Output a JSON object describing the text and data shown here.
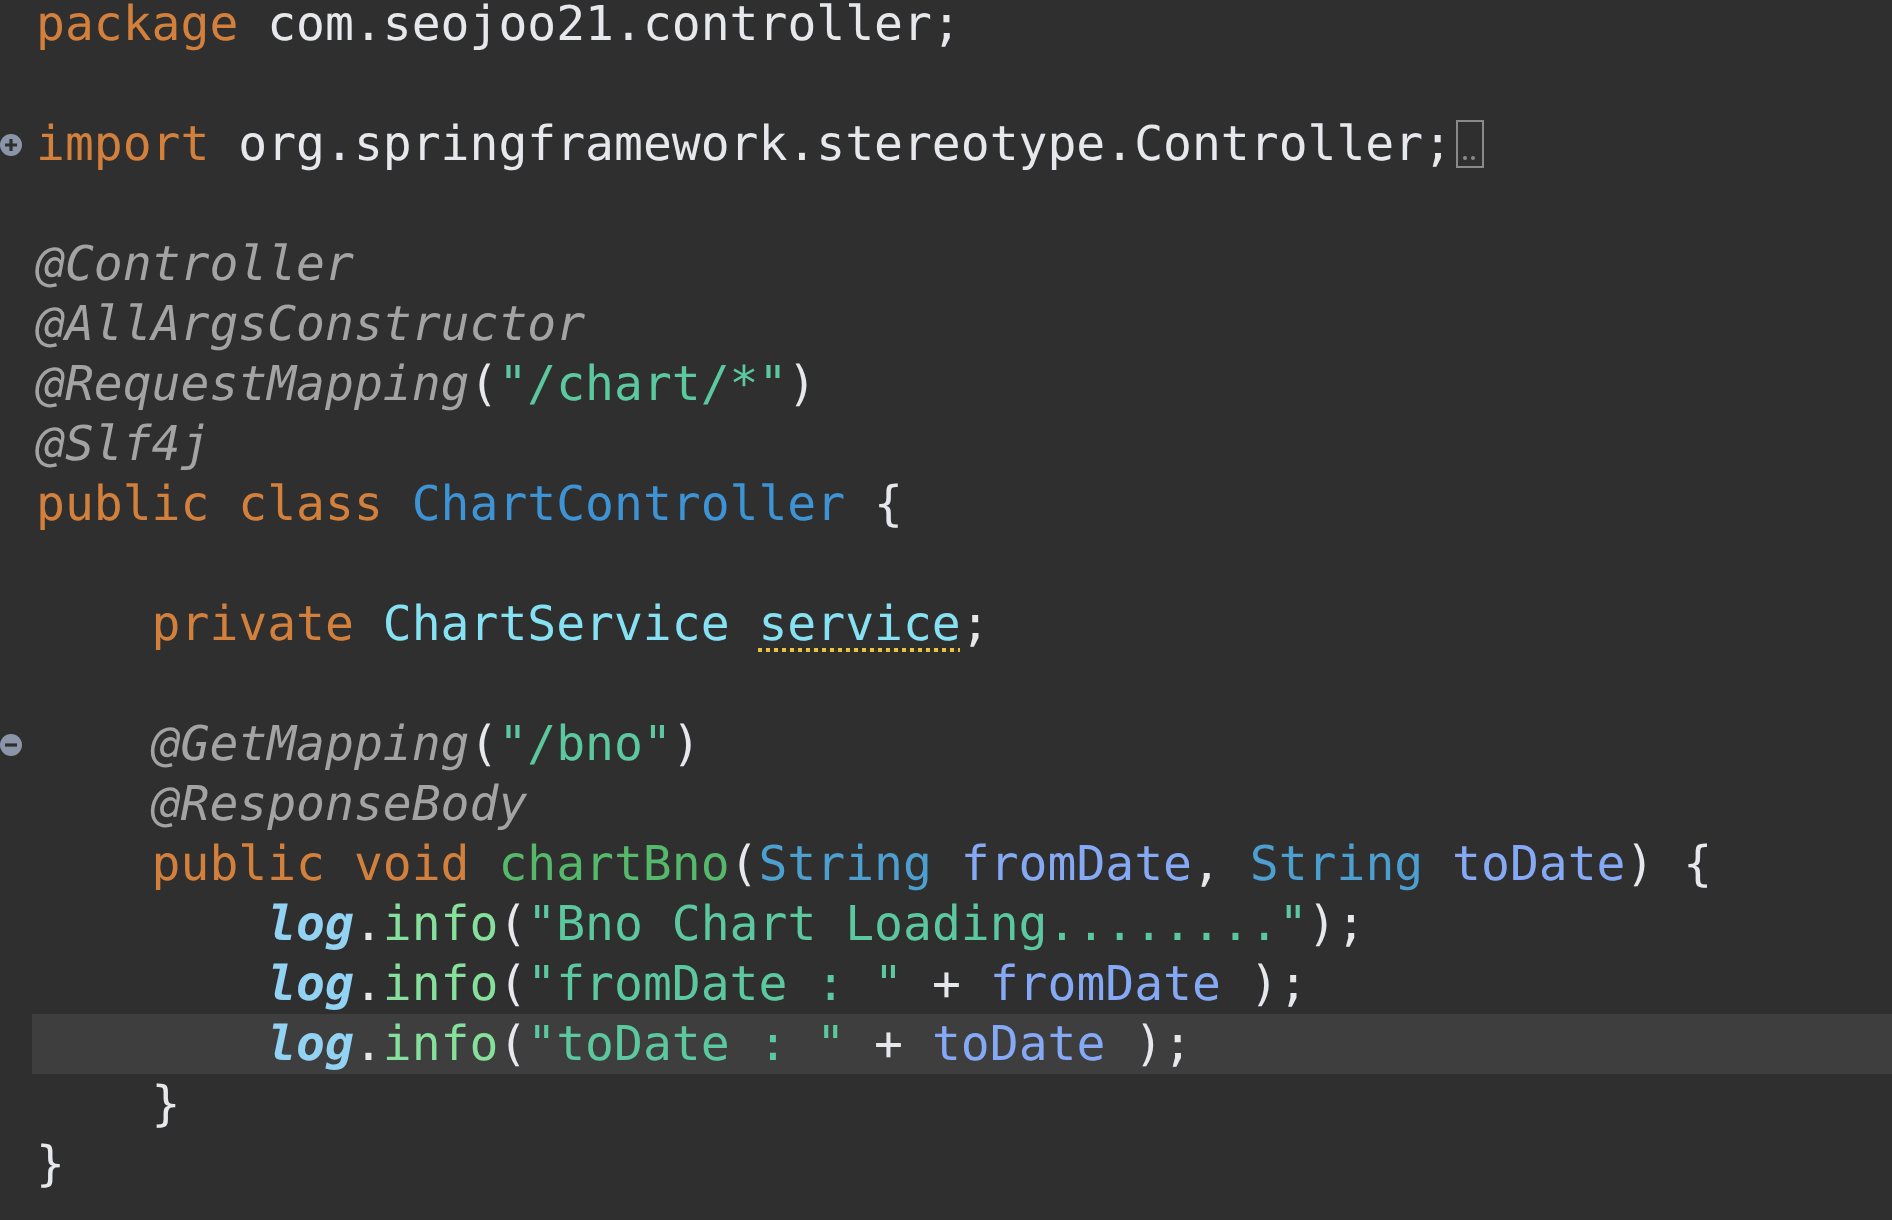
{
  "editor": {
    "lines": [
      {
        "current": false,
        "tokens": [
          {
            "text": "package",
            "kind": "keyword"
          },
          {
            "text": " com.seojoo21.controller;",
            "kind": "plain"
          }
        ]
      },
      {
        "current": false
      },
      {
        "current": false,
        "folded": true,
        "tokens": [
          {
            "text": "import",
            "kind": "keyword"
          },
          {
            "text": " org.springframework.stereotype.Controller;",
            "kind": "plain"
          }
        ]
      },
      {
        "current": false
      },
      {
        "current": false,
        "tokens": [
          {
            "text": "@Controller",
            "kind": "annotation"
          }
        ]
      },
      {
        "current": false,
        "tokens": [
          {
            "text": "@AllArgsConstructor",
            "kind": "annotation"
          }
        ]
      },
      {
        "current": false,
        "tokens": [
          {
            "text": "@RequestMapping",
            "kind": "annotation"
          },
          {
            "text": "(",
            "kind": "plain"
          },
          {
            "text": "\"/chart/*\"",
            "kind": "string"
          },
          {
            "text": ")",
            "kind": "plain"
          }
        ]
      },
      {
        "current": false,
        "tokens": [
          {
            "text": "@Slf4j",
            "kind": "annotation"
          }
        ]
      },
      {
        "current": false,
        "tokens": [
          {
            "text": "public class ",
            "kind": "keyword"
          },
          {
            "text": "ChartController",
            "kind": "class"
          },
          {
            "text": " {",
            "kind": "plain"
          }
        ]
      },
      {
        "current": false
      },
      {
        "current": false,
        "tokens": [
          {
            "text": "    private ",
            "kind": "keyword"
          },
          {
            "text": "ChartService ",
            "kind": "type"
          },
          {
            "text": "service",
            "kind": "type",
            "warning": true
          },
          {
            "text": ";",
            "kind": "plain"
          }
        ]
      },
      {
        "current": false
      },
      {
        "current": false,
        "folded": false,
        "tokens": [
          {
            "text": "    @GetMapping",
            "kind": "annotation"
          },
          {
            "text": "(",
            "kind": "plain"
          },
          {
            "text": "\"/bno\"",
            "kind": "string"
          },
          {
            "text": ")",
            "kind": "plain"
          }
        ]
      },
      {
        "current": false,
        "tokens": [
          {
            "text": "    @ResponseBody",
            "kind": "annotation"
          }
        ]
      },
      {
        "current": false,
        "tokens": [
          {
            "text": "    public void ",
            "kind": "keyword"
          },
          {
            "text": "chartBno",
            "kind": "method"
          },
          {
            "text": "(",
            "kind": "plain"
          },
          {
            "text": "String ",
            "kind": "builtin"
          },
          {
            "text": "fromDate",
            "kind": "param"
          },
          {
            "text": ", ",
            "kind": "plain"
          },
          {
            "text": "String ",
            "kind": "builtin"
          },
          {
            "text": "toDate",
            "kind": "param"
          },
          {
            "text": ") {",
            "kind": "plain"
          }
        ]
      },
      {
        "current": false,
        "tokens": [
          {
            "text": "        log",
            "kind": "log"
          },
          {
            "text": ".",
            "kind": "plain"
          },
          {
            "text": "info",
            "kind": "call"
          },
          {
            "text": "(",
            "kind": "plain"
          },
          {
            "text": "\"Bno Chart Loading........\"",
            "kind": "string"
          },
          {
            "text": ");",
            "kind": "plain"
          }
        ]
      },
      {
        "current": false,
        "tokens": [
          {
            "text": "        log",
            "kind": "log"
          },
          {
            "text": ".",
            "kind": "plain"
          },
          {
            "text": "info",
            "kind": "call"
          },
          {
            "text": "(",
            "kind": "plain"
          },
          {
            "text": "\"fromDate : \"",
            "kind": "string"
          },
          {
            "text": " + ",
            "kind": "plain"
          },
          {
            "text": "fromDate",
            "kind": "param"
          },
          {
            "text": " );",
            "kind": "plain"
          }
        ]
      },
      {
        "current": true,
        "tokens": [
          {
            "text": "        log",
            "kind": "log"
          },
          {
            "text": ".",
            "kind": "plain"
          },
          {
            "text": "info",
            "kind": "call"
          },
          {
            "text": "(",
            "kind": "plain"
          },
          {
            "text": "\"toDate : \"",
            "kind": "string"
          },
          {
            "text": " + ",
            "kind": "plain"
          },
          {
            "text": "toDate",
            "kind": "param"
          },
          {
            "text": " );",
            "kind": "plain"
          }
        ]
      },
      {
        "current": false,
        "tokens": [
          {
            "text": "    }",
            "kind": "plain"
          }
        ]
      },
      {
        "current": false,
        "tokens": [
          {
            "text": "}",
            "kind": "plain"
          }
        ]
      }
    ]
  }
}
